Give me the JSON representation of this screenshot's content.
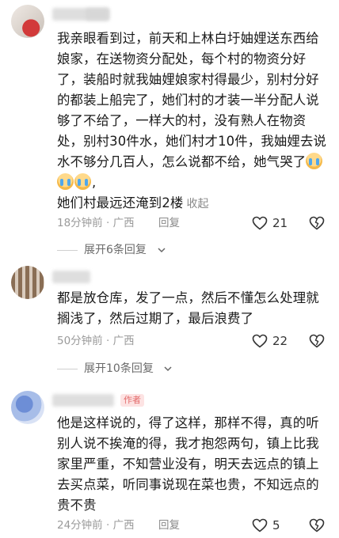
{
  "comments": [
    {
      "text": "我亲眼看到过，前天和上林白圩妯娌送东西给娘家，在送物资分配处，每个村的物资分好了，装船时就我妯娌娘家村得最少，别村分好的都装上船完了，她们村的才装一半分配人说够了不给了，一样大的村，没有熟人在物资处，别村30件水，她们村才10件，我妯娌去说水不够分几百人，怎么说都不给，她气哭了",
      "text_after_emoji": "她们村最远还淹到2楼",
      "emojis": [
        "crying-emoji",
        "crying-emoji",
        "crying-emoji"
      ],
      "collapse_label": "收起",
      "time": "18分钟前",
      "location": "广西",
      "reply_label": "回复",
      "likes": "21",
      "expand_label": "展开6条回复"
    },
    {
      "text": "都是放仓库，发了一点，然后不懂怎么处理就搁浅了，然后过期了，最后浪费了",
      "time": "50分钟前",
      "location": "广西",
      "reply_label": "回复",
      "likes": "22",
      "expand_label": "展开10条回复"
    },
    {
      "badge": "作者",
      "text": "他是这样说的，得了这样，那样不得，真的听别人说不挨淹的得，我才抱怨两句，镇上比我家里严重，不知营业没有，明天去远点的镇上去买点菜，听同事说现在菜也贵，不知远点的贵不贵",
      "time": "24分钟前",
      "location": "广西",
      "reply_label": "回复",
      "likes": "5"
    }
  ],
  "separator": "·"
}
